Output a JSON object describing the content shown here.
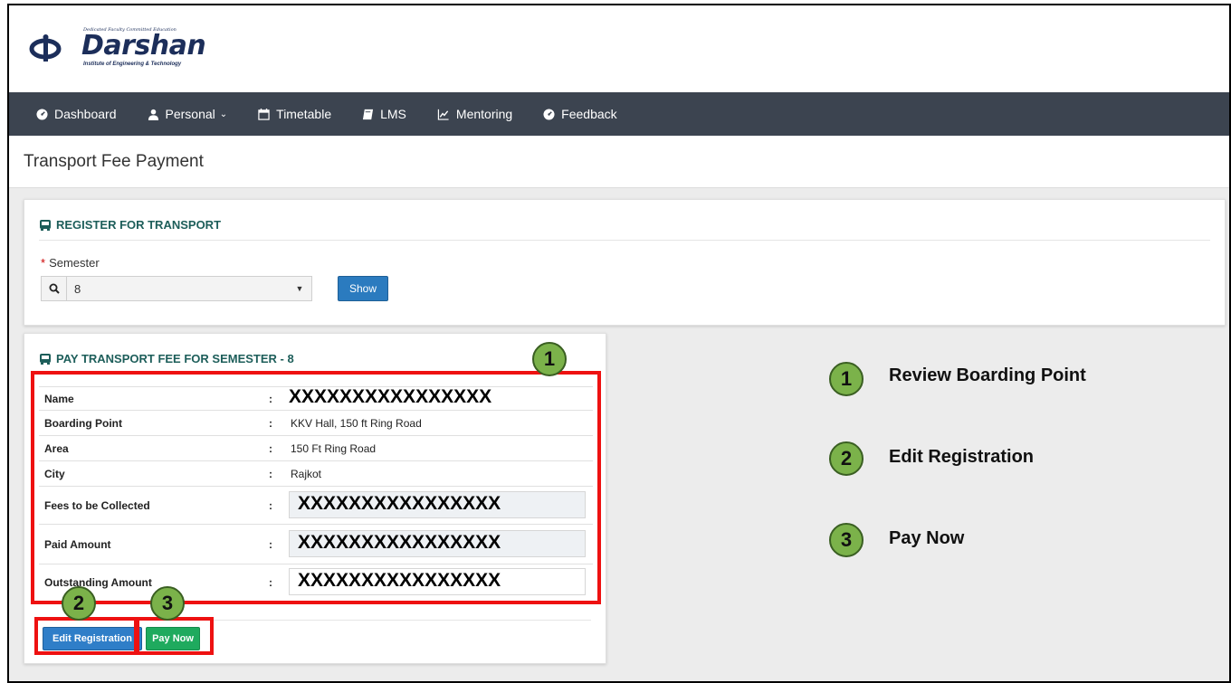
{
  "brand": {
    "name": "Darshan",
    "tagline": "Dedicated Faculty Committed Education",
    "subtitle": "Institute of Engineering & Technology"
  },
  "nav": [
    {
      "label": "Dashboard",
      "icon": "dashboard-icon"
    },
    {
      "label": "Personal",
      "icon": "user-icon",
      "has_caret": true
    },
    {
      "label": "Timetable",
      "icon": "calendar-icon"
    },
    {
      "label": "LMS",
      "icon": "book-icon"
    },
    {
      "label": "Mentoring",
      "icon": "chart-line-icon"
    },
    {
      "label": "Feedback",
      "icon": "dashboard-icon"
    }
  ],
  "page": {
    "title": "Transport Fee Payment"
  },
  "register": {
    "heading": "REGISTER FOR TRANSPORT",
    "semester_label": "Semester",
    "semester_value": "8",
    "show_button": "Show"
  },
  "pay": {
    "heading": "PAY TRANSPORT FEE FOR SEMESTER - 8",
    "rows": [
      {
        "label": "Name",
        "value": "XXXXXXXXXXXXXXXX"
      },
      {
        "label": "Boarding Point",
        "value": "KKV Hall, 150 ft Ring Road"
      },
      {
        "label": "Area",
        "value": "150 Ft Ring Road"
      },
      {
        "label": "City",
        "value": "Rajkot"
      },
      {
        "label": "Fees to be Collected",
        "value": "XXXXXXXXXXXXXXXX"
      },
      {
        "label": "Paid Amount",
        "value": "XXXXXXXXXXXXXXXX"
      },
      {
        "label": "Outstanding Amount",
        "value": "XXXXXXXXXXXXXXXX"
      }
    ],
    "colon": ":",
    "edit_button": "Edit Registration",
    "pay_button": "Pay Now"
  },
  "annotations": {
    "badges": [
      "1",
      "2",
      "3"
    ],
    "legend": [
      {
        "num": "1",
        "text": "Review Boarding Point"
      },
      {
        "num": "2",
        "text": "Edit Registration"
      },
      {
        "num": "3",
        "text": "Pay Now"
      }
    ]
  },
  "colors": {
    "navbar": "#3c4450",
    "heading": "#1d5e5a",
    "show_button": "#2b7bbf",
    "edit_button": "#2f7ec8",
    "pay_button": "#1faa5e",
    "annotation_red": "#ee1111",
    "badge_green": "#7bb24a"
  }
}
